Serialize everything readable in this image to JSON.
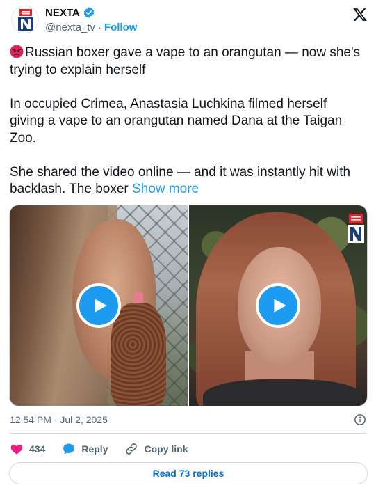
{
  "author": {
    "name": "NEXTA",
    "handle": "@nexta_tv",
    "separator": "·",
    "follow_label": "Follow",
    "verified": true,
    "avatar_icon": "nexta-logo-icon"
  },
  "tweet": {
    "emoji": "angry-face-emoji",
    "headline": "Russian boxer gave a vape to an orangutan — now she's trying to explain herself",
    "paragraph_2": "In occupied Crimea, Anastasia Luchkina filmed herself giving a vape to an orangutan named Dana at the Taigan Zoo.",
    "paragraph_3": "She shared the video online — and it was instantly hit with backlash. The boxer",
    "show_more_label": "Show more"
  },
  "media": {
    "videos": [
      {
        "icon": "play-icon"
      },
      {
        "icon": "play-icon"
      }
    ]
  },
  "meta": {
    "timestamp": "12:54 PM · Jul 2, 2025"
  },
  "actions": {
    "like_count": "434",
    "reply_label": "Reply",
    "copy_link_label": "Copy link"
  },
  "read_replies_label": "Read 73 replies",
  "colors": {
    "accent": "#1d9bf0",
    "like": "#f91880",
    "text": "#0f1419",
    "muted": "#536471",
    "read_replies": "#006fd6"
  }
}
